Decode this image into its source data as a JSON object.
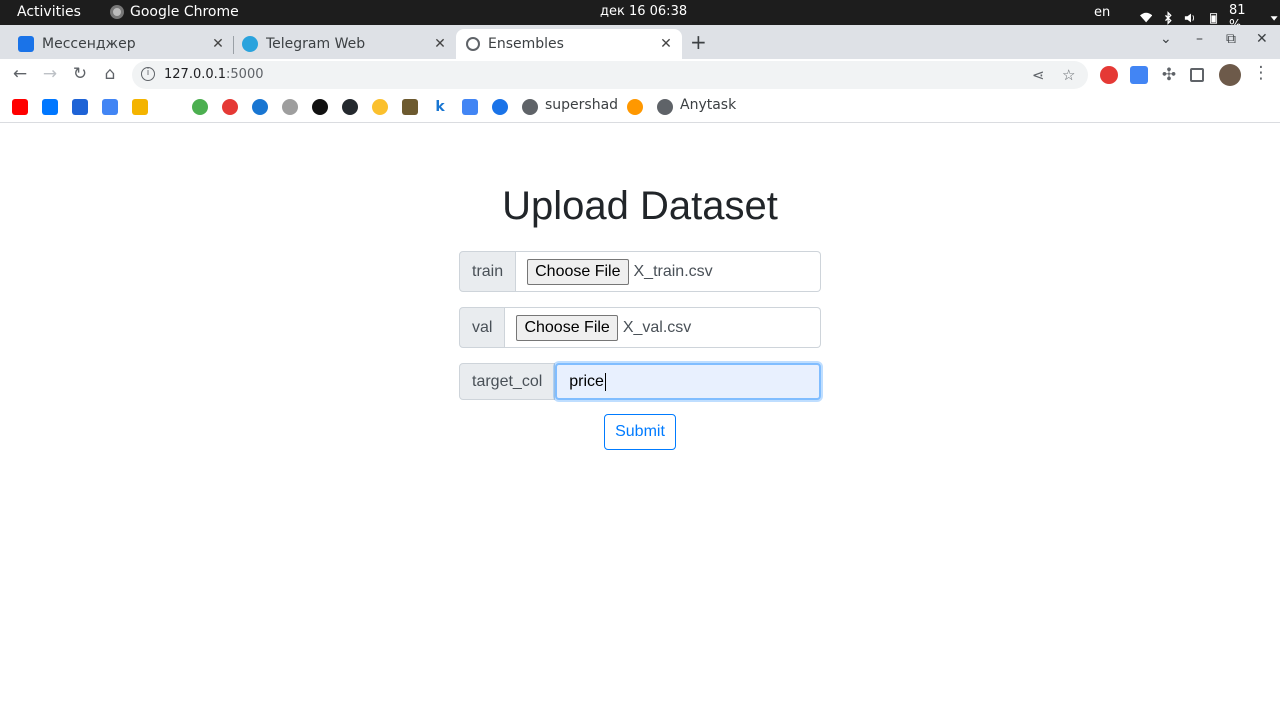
{
  "system_bar": {
    "activities": "Activities",
    "app_name": "Google Chrome",
    "clock": "дек 16  06:38",
    "language": "en",
    "battery": "81 %"
  },
  "tabs": [
    {
      "title": "Мессенджер",
      "close": "✕",
      "favicon_color": "#1a73e8"
    },
    {
      "title": "Telegram Web",
      "close": "✕",
      "favicon_color": "#2aa3dd"
    },
    {
      "title": "Ensembles",
      "close": "✕",
      "favicon_color": "#5f6368"
    }
  ],
  "new_tab": "+",
  "toolbar": {
    "url_host": "127.0.0.1",
    "url_port": ":5000"
  },
  "bookmarks": {
    "labeled": [
      {
        "label": "supershad"
      },
      {
        "label": "Anytask"
      }
    ]
  },
  "page": {
    "heading": "Upload Dataset",
    "train": {
      "label": "train",
      "button": "Choose File",
      "file": "X_train.csv"
    },
    "val": {
      "label": "val",
      "button": "Choose File",
      "file": "X_val.csv"
    },
    "target": {
      "label": "target_col",
      "value": "price"
    },
    "submit": "Submit"
  },
  "colors": {
    "primary": "#007bff",
    "addon_bg": "#e9ecef",
    "focus_bg": "#e8f0fe"
  }
}
